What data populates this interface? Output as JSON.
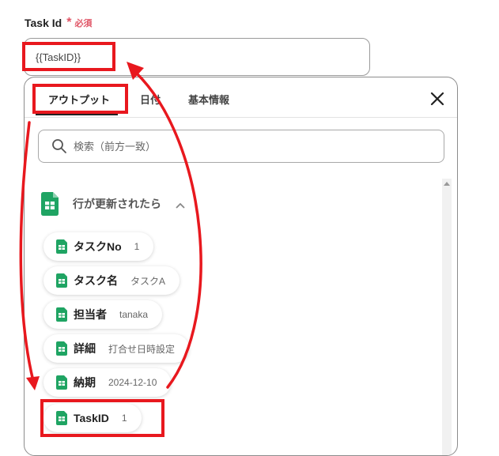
{
  "field": {
    "label": "Task Id",
    "required_mark": "*",
    "required_text": "必須",
    "value": "{{TaskID}}"
  },
  "panel": {
    "tabs": [
      {
        "label": "アウトプット",
        "active": true
      },
      {
        "label": "日付",
        "active": false
      },
      {
        "label": "基本情報",
        "active": false
      }
    ],
    "search": {
      "placeholder": "検索（前方一致）"
    },
    "group": {
      "title": "行が更新されたら",
      "icon": "google-sheets-icon",
      "expanded": true
    },
    "items": [
      {
        "label": "タスクNo",
        "value": "1"
      },
      {
        "label": "タスク名",
        "value": "タスクA"
      },
      {
        "label": "担当者",
        "value": "tanaka"
      },
      {
        "label": "詳細",
        "value": "打合せ日時設定"
      },
      {
        "label": "納期",
        "value": "2024-12-10"
      },
      {
        "label": "TaskID",
        "value": "1"
      }
    ]
  },
  "colors": {
    "highlight": "#e8181e",
    "sheets_green": "#1fa463",
    "required": "#e05566"
  }
}
